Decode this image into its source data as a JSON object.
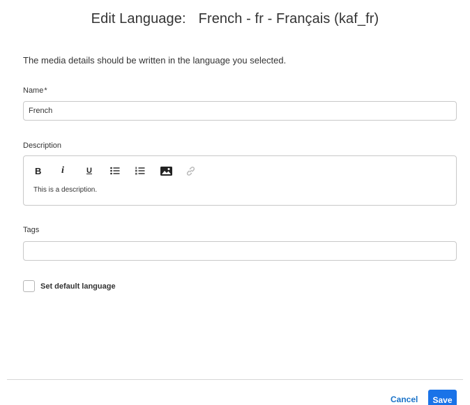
{
  "dialog": {
    "title_prefix": "Edit Language:",
    "title_language": "French - fr - Français (kaf_fr)",
    "intro": "The media details should be written in the language you selected."
  },
  "form": {
    "name": {
      "label": "Name",
      "required_mark": "*",
      "value": "French"
    },
    "description": {
      "label": "Description",
      "toolbar": {
        "bold_label": "B",
        "italic_label": "i",
        "underline_label": "U",
        "icons": [
          "bullet-list-icon",
          "numbered-list-icon",
          "image-icon",
          "link-icon"
        ]
      },
      "content": "This is a description."
    },
    "tags": {
      "label": "Tags",
      "value": ""
    },
    "default_language": {
      "label": "Set default language",
      "checked": false
    }
  },
  "footer": {
    "cancel_label": "Cancel",
    "save_label": "Save"
  },
  "colors": {
    "primary": "#1a73e8",
    "link": "#1a73c9",
    "border": "#c8c8c8"
  }
}
